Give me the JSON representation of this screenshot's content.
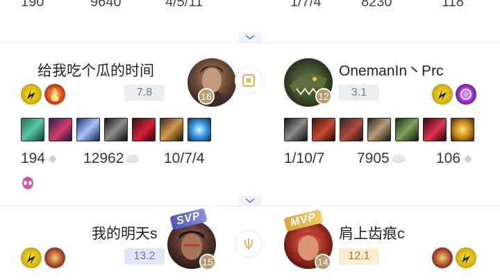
{
  "prev_row": {
    "left_stats": [
      "190",
      "9640",
      "4/5/11"
    ],
    "right_stats": [
      "1/7/4",
      "8230",
      "118"
    ]
  },
  "match": {
    "left": {
      "name": "给我吃个瓜的时间",
      "level": "16",
      "score": "7.8",
      "spells": [
        "flash-spell-icon",
        "smite-spell-icon"
      ],
      "items": [
        "trident-item-icon",
        "sword-item-icon",
        "armor-item-icon",
        "dagger-item-icon",
        "boots-item-icon",
        "bow-item-icon",
        "crystal-item-icon"
      ],
      "stats": [
        "194",
        "12962",
        "10/7/4"
      ],
      "extra_icon": "alien-icon"
    },
    "right": {
      "name": "OnemanIn丶Prc",
      "level": "12",
      "score": "3.1",
      "spells": [
        "flash-spell-icon",
        "purple-spell-icon"
      ],
      "items": [
        "dagger-item-icon",
        "axe-item-icon",
        "boots-item-icon",
        "gauntlet-item-icon",
        "armor-item-icon",
        "gem-item-icon",
        "lantern-item-icon"
      ],
      "stats": [
        "1/10/7",
        "7905",
        "106"
      ]
    }
  },
  "match2": {
    "left": {
      "name": "我的明天s",
      "level": "15",
      "score": "13.2",
      "badge": "SVP"
    },
    "right": {
      "name": "肩上齿痕c",
      "level": "14",
      "score": "12.1",
      "badge": "MVP"
    }
  },
  "colors": {
    "score_gray": "#e8eef2",
    "svp": "#6f73b8",
    "mvp": "#d9a53b",
    "level": "#b59a6d"
  }
}
